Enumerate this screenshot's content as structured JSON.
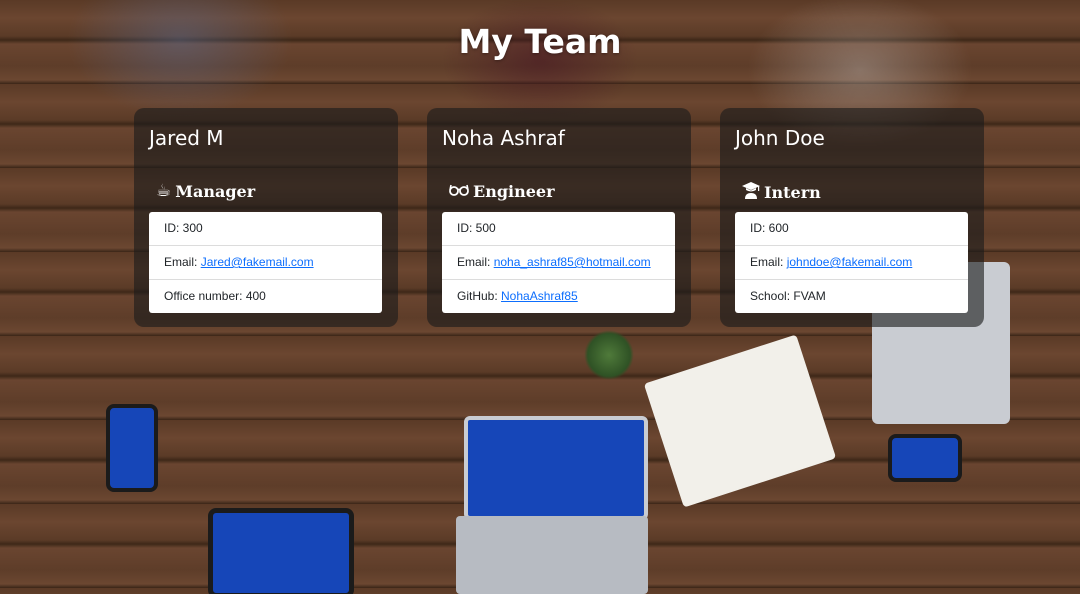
{
  "page": {
    "title": "My Team"
  },
  "colors": {
    "card_background": "#1c1c1c",
    "link": "#0d6efd",
    "text_white": "#ffffff",
    "list_background": "#ffffff"
  },
  "employees": [
    {
      "name": "Jared M",
      "role": "Manager",
      "role_icon": "mug-icon",
      "id_label": "ID: ",
      "id": "300",
      "email_label": "Email: ",
      "email": "Jared@fakemail.com",
      "extra_label": "Office number: ",
      "extra_value": "400"
    },
    {
      "name": "Noha Ashraf",
      "role": "Engineer",
      "role_icon": "glasses-icon",
      "id_label": "ID: ",
      "id": "500",
      "email_label": "Email: ",
      "email": "noha_ashraf85@hotmail.com",
      "extra_label": "GitHub: ",
      "extra_value": "NohaAshraf85"
    },
    {
      "name": "John Doe",
      "role": "Intern",
      "role_icon": "graduate-icon",
      "id_label": "ID: ",
      "id": "600",
      "email_label": "Email: ",
      "email": "johndoe@fakemail.com",
      "extra_label": "School: ",
      "extra_value": "FVAM"
    }
  ]
}
